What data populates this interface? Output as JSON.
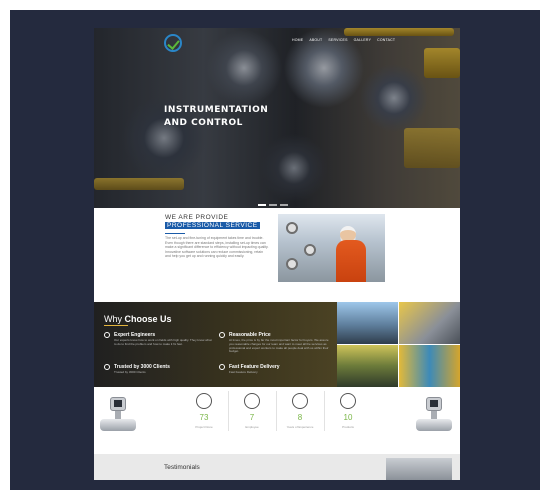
{
  "nav": {
    "items": [
      "HOME",
      "ABOUT",
      "SERVICES",
      "GALLERY",
      "CONTACT"
    ]
  },
  "hero": {
    "title": "INSTRUMENTATION AND CONTROL"
  },
  "about": {
    "pre_title": "WE ARE PROVIDE",
    "main_title": "PROFESSIONAL SERVICE",
    "text": "The set-up and fine-tuning of equipment takes time and trouble. Even though there are standard steps, installing set-up times can make a significant difference to efficiency without impacting quality. Innovative software solutions can reduce commissioning, retain and help you get up and running quickly and easily."
  },
  "why": {
    "title_light": "Why",
    "title_bold": "Choose Us",
    "features": [
      {
        "title": "Expert Engineers",
        "desc": "Our experts know how to work on fields with high quality. They know what to do to find the problem and how to make it fix fast."
      },
      {
        "title": "Reasonable Price",
        "desc": "At times, the price is by far the most important factor for buyers. We assure you reasonable charges for our team and want to meet all the services as professional and expert workers to make all people deal with us within their budget."
      },
      {
        "title": "Trusted by 3000 Clients",
        "desc": "Trusted by 3000 Clients"
      },
      {
        "title": "Fast Feature Delivery",
        "desc": "Fast Feature Delivery"
      }
    ]
  },
  "stats": [
    {
      "value": "73",
      "label": "Project Done",
      "icon": "people-icon"
    },
    {
      "value": "7",
      "label": "Employee",
      "icon": "engineer-icon"
    },
    {
      "value": "8",
      "label": "Years of Experience",
      "icon": "hierarchy-icon"
    },
    {
      "value": "10",
      "label": "Products",
      "icon": "gear-icon"
    }
  ],
  "testimonials": {
    "title": "Testimonials"
  },
  "colors": {
    "accent_blue": "#1a5ba8",
    "accent_green": "#7ab648",
    "accent_yellow": "#e3b43c"
  }
}
